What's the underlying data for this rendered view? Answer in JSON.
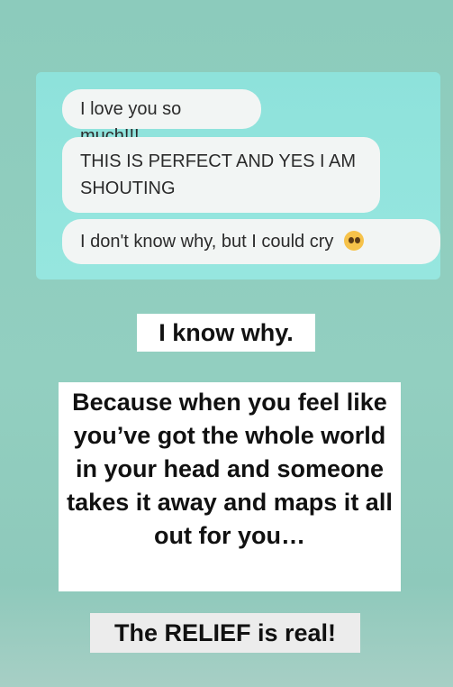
{
  "chat": {
    "messages": [
      {
        "text": "I love you so much!!!"
      },
      {
        "text": "THIS IS PERFECT AND YES I AM SHOUTING"
      },
      {
        "text": "I don't know why, but I could cry"
      }
    ],
    "emoji_icon": "pleading-face-emoji"
  },
  "captions": {
    "first": "I know why.",
    "second": "Because when you feel like you’ve got the whole world in your head and someone takes it away and maps it all out for you…",
    "third": "The RELIEF is real!"
  },
  "colors": {
    "background": "#8ccbbc",
    "chat_panel": "#8ee2db",
    "bubble": "#f2f5f4",
    "caption_bg": "#ffffff"
  }
}
